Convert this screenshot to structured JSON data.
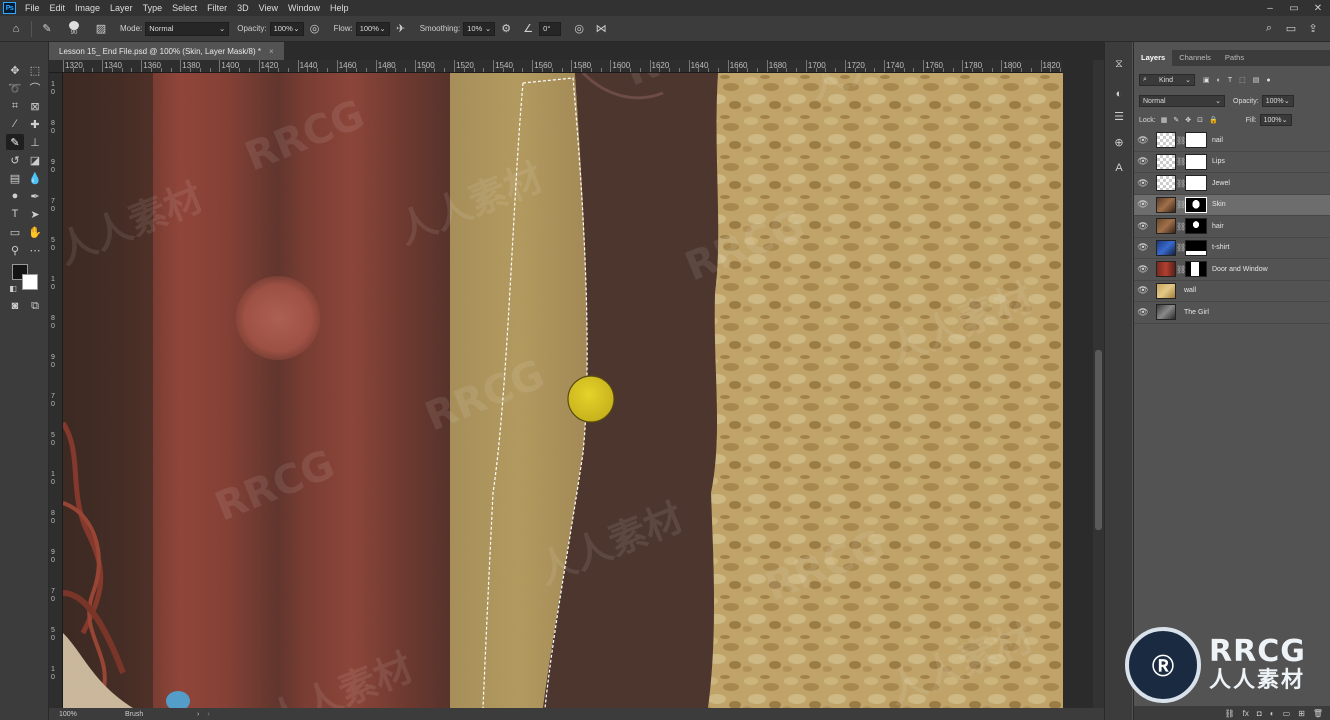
{
  "app": {
    "logo": "Ps"
  },
  "menu": [
    "File",
    "Edit",
    "Image",
    "Layer",
    "Type",
    "Select",
    "Filter",
    "3D",
    "View",
    "Window",
    "Help"
  ],
  "options": {
    "brush_size": "90",
    "mode_label": "Mode:",
    "mode_value": "Normal",
    "opacity_label": "Opacity:",
    "opacity_value": "100%",
    "flow_label": "Flow:",
    "flow_value": "100%",
    "smoothing_label": "Smoothing:",
    "smoothing_value": "10%",
    "angle_value": "0°"
  },
  "document": {
    "tab_title": "Lesson 15_ End File.psd @ 100% (Skin, Layer Mask/8) *",
    "close": "×"
  },
  "ruler": {
    "h_labels": [
      "1320",
      "1340",
      "1360",
      "1380",
      "1400",
      "1420",
      "1440",
      "1460",
      "1480",
      "1500",
      "1520",
      "1540",
      "1560",
      "1580",
      "1600",
      "1620",
      "1640",
      "1660",
      "1680",
      "1700",
      "1720",
      "1740",
      "1760",
      "1780",
      "1800",
      "1820"
    ],
    "v_labels": [
      "1",
      "0",
      "8",
      "0",
      "9",
      "0",
      "7",
      "0",
      "5",
      "0"
    ]
  },
  "status": {
    "zoom": "100%",
    "tool": "Brush",
    "arrow": "›"
  },
  "panel": {
    "tabs": [
      "Layers",
      "Channels",
      "Paths"
    ],
    "kind_label": "Kind",
    "blend_mode": "Normal",
    "opacity_label": "Opacity:",
    "opacity_value": "100%",
    "lock_label": "Lock:",
    "fill_label": "Fill:",
    "fill_value": "100%",
    "layers": [
      {
        "name": "nail",
        "thumb": "checker",
        "mask": "white",
        "selected": false
      },
      {
        "name": "Lips",
        "thumb": "checker",
        "mask": "white",
        "selected": false
      },
      {
        "name": "Jewel",
        "thumb": "checker",
        "mask": "white",
        "selected": false
      },
      {
        "name": "Skin",
        "thumb": "photo",
        "mask": "figure",
        "selected": true
      },
      {
        "name": "hair",
        "thumb": "photo",
        "mask": "hair",
        "selected": false
      },
      {
        "name": "t-shirt",
        "thumb": "blue",
        "mask": "shirt",
        "selected": false
      },
      {
        "name": "Door and Window",
        "thumb": "red",
        "mask": "door",
        "selected": false
      },
      {
        "name": "wall",
        "thumb": "tan",
        "mask": "",
        "selected": false
      },
      {
        "name": "The Girl",
        "thumb": "photo",
        "mask": "",
        "selected": false
      }
    ]
  },
  "watermarks": {
    "latin": "RRCG",
    "cjk": "人人素材"
  },
  "brand": {
    "logo_text": "RRCG",
    "logo_sub": "人人素材"
  },
  "colors": {
    "accent": "#31a8ff",
    "foreground": "#151515",
    "background": "#ffffff",
    "brush_cursor": "#d4c022"
  }
}
